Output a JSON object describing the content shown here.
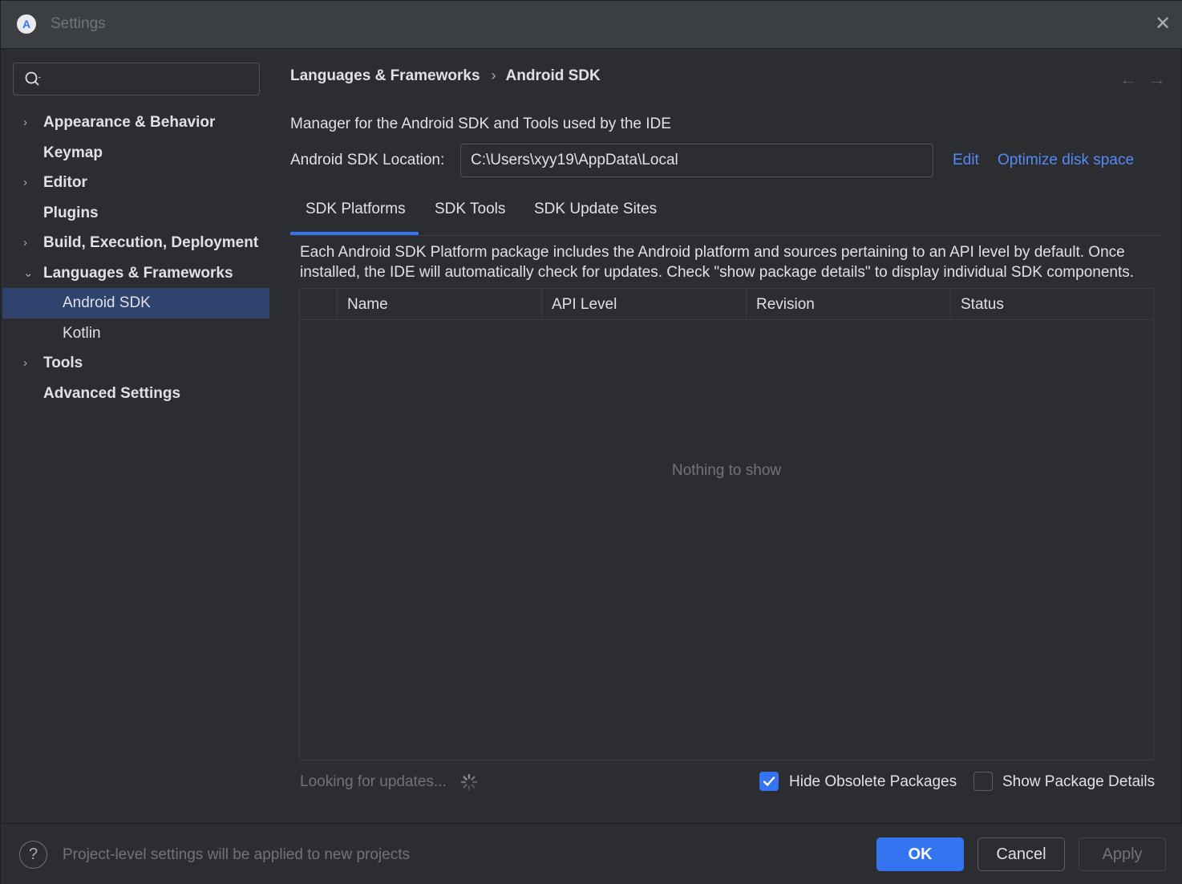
{
  "window": {
    "title": "Settings",
    "close_label": "✕"
  },
  "search": {
    "placeholder": ""
  },
  "sidebar": {
    "items": [
      {
        "label": "Appearance & Behavior",
        "chevron": "›"
      },
      {
        "label": "Keymap",
        "chevron": ""
      },
      {
        "label": "Editor",
        "chevron": "›"
      },
      {
        "label": "Plugins",
        "chevron": ""
      },
      {
        "label": "Build, Execution, Deployment",
        "chevron": "›"
      },
      {
        "label": "Languages & Frameworks",
        "chevron": "⌄"
      },
      {
        "label": "Android SDK",
        "chevron": ""
      },
      {
        "label": "Kotlin",
        "chevron": ""
      },
      {
        "label": "Tools",
        "chevron": "›"
      },
      {
        "label": "Advanced Settings",
        "chevron": ""
      }
    ],
    "selected": "Android SDK"
  },
  "breadcrumb": {
    "parent": "Languages & Frameworks",
    "separator": "›",
    "current": "Android SDK"
  },
  "nav": {
    "back": "←",
    "forward": "→"
  },
  "main": {
    "description": "Manager for the Android SDK and Tools used by the IDE",
    "location_label": "Android SDK Location:",
    "location_value": "C:\\Users\\xyy19\\AppData\\Local",
    "edit_link": "Edit",
    "optimize_link": "Optimize disk space"
  },
  "tabs": [
    {
      "label": "SDK Platforms"
    },
    {
      "label": "SDK Tools"
    },
    {
      "label": "SDK Update Sites"
    }
  ],
  "tab_description": "Each Android SDK Platform package includes the Android platform and sources pertaining to an API level by default. Once installed, the IDE will automatically check for updates. Check \"show package details\" to display individual SDK components.",
  "table": {
    "columns": [
      "",
      "Name",
      "API Level",
      "Revision",
      "Status"
    ],
    "empty_text": "Nothing to show"
  },
  "status": {
    "updates_text": "Looking for updates...",
    "hide_obsolete": {
      "label": "Hide Obsolete Packages",
      "checked": true
    },
    "show_details": {
      "label": "Show Package Details",
      "checked": false
    }
  },
  "footer": {
    "help_label": "?",
    "note": "Project-level settings will be applied to new projects",
    "ok": "OK",
    "cancel": "Cancel",
    "apply": "Apply"
  },
  "colors": {
    "accent": "#3574f0",
    "link": "#548af7",
    "selection": "#2e436e",
    "background": "#2b2d30"
  }
}
